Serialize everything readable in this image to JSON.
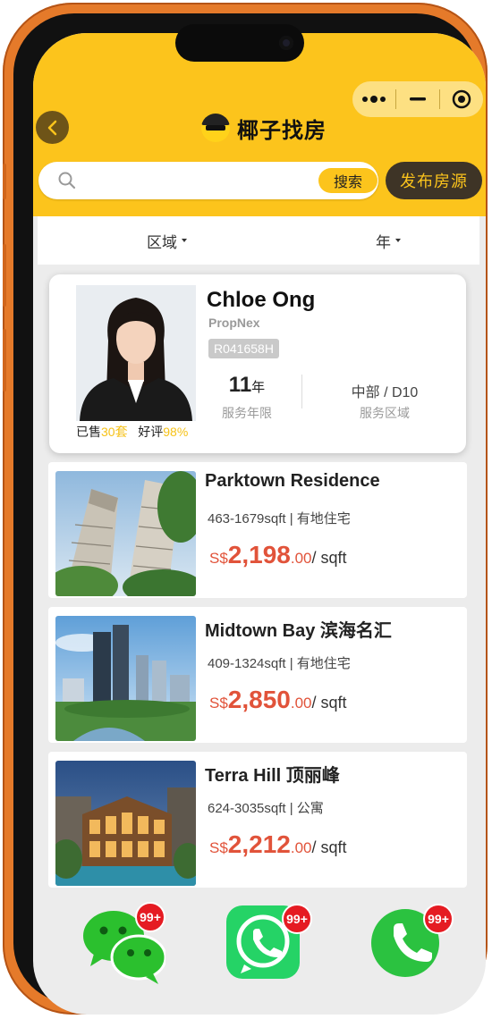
{
  "app": {
    "title": "椰子找房"
  },
  "search": {
    "placeholder": "",
    "button_label": "搜索"
  },
  "publish_button_label": "发布房源",
  "filters": [
    {
      "label": "区域"
    },
    {
      "label": "年"
    }
  ],
  "agent": {
    "name": "Chloe Ong",
    "company": "PropNex",
    "license": "R041658H",
    "sold_label": "已售",
    "sold_count": "30套",
    "rating_label": "好评",
    "rating_value": "98%",
    "years_value": "11",
    "years_unit": "年",
    "years_label": "服务年限",
    "area_value": "中部 / D10",
    "area_label": "服务区域"
  },
  "listings": [
    {
      "name": "Parktown Residence",
      "spec": "463-1679sqft | 有地住宅",
      "currency": "S$",
      "price_int": "2,198",
      "price_dec": ".00",
      "price_unit": "/ sqft"
    },
    {
      "name": "Midtown Bay 滨海名汇",
      "spec": "409-1324sqft | 有地住宅",
      "currency": "S$",
      "price_int": "2,850",
      "price_dec": ".00",
      "price_unit": "/ sqft"
    },
    {
      "name": "Terra Hill 顶丽峰",
      "spec": "624-3035sqft | 公寓",
      "currency": "S$",
      "price_int": "2,212",
      "price_dec": ".00",
      "price_unit": "/ sqft"
    }
  ],
  "contacts": [
    {
      "icon": "wechat-icon",
      "badge": "99+"
    },
    {
      "icon": "whatsapp-icon",
      "badge": "99+"
    },
    {
      "icon": "phone-icon",
      "badge": "99+"
    }
  ],
  "colors": {
    "brand_yellow": "#fcc41c",
    "price_red": "#e1533a",
    "wechat_green": "#2bc02e",
    "whatsapp_green": "#25d366",
    "badge_red": "#e51b22",
    "phone_frame": "#e57a2a"
  }
}
